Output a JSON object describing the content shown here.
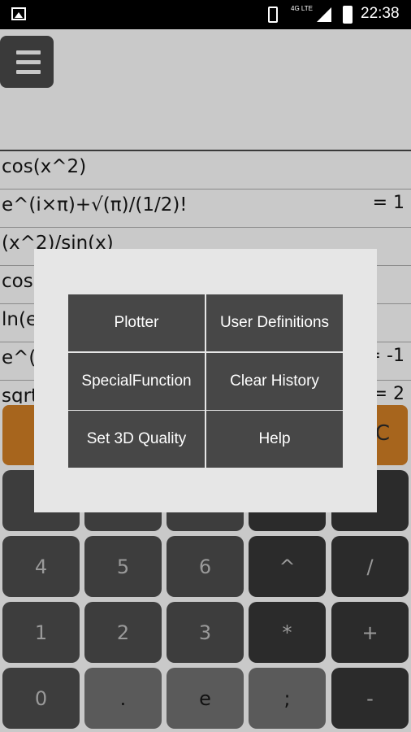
{
  "status_bar": {
    "network": "4G LTE",
    "time": "22:38"
  },
  "history": [
    {
      "expr": "cos(x^2)",
      "result": ""
    },
    {
      "expr": "e^(i×π)+√(π)/(1/2)!",
      "result": "= 1"
    },
    {
      "expr": "(x^2)/sin(x)",
      "result": ""
    },
    {
      "expr": "cos",
      "result": ""
    },
    {
      "expr": "ln(e",
      "result": ""
    },
    {
      "expr": "e^(i",
      "result": "= -1"
    },
    {
      "expr": "sqrt",
      "result": "= 2"
    }
  ],
  "clear_row": {
    "right_label": "C"
  },
  "keypad": {
    "keys": [
      "4",
      "5",
      "6",
      "^",
      "/",
      "1",
      "2",
      "3",
      "*",
      "+",
      "0",
      ".",
      "e",
      ";",
      "-"
    ]
  },
  "menu_dialog": {
    "items": [
      "Plotter",
      "User Definitions",
      "SpecialFunction",
      "Clear History",
      "Set 3D Quality",
      "Help"
    ]
  },
  "colors": {
    "accent_orange": "#a7651d",
    "dialog_bg": "#e6e6e6",
    "menu_cell": "#474747"
  }
}
